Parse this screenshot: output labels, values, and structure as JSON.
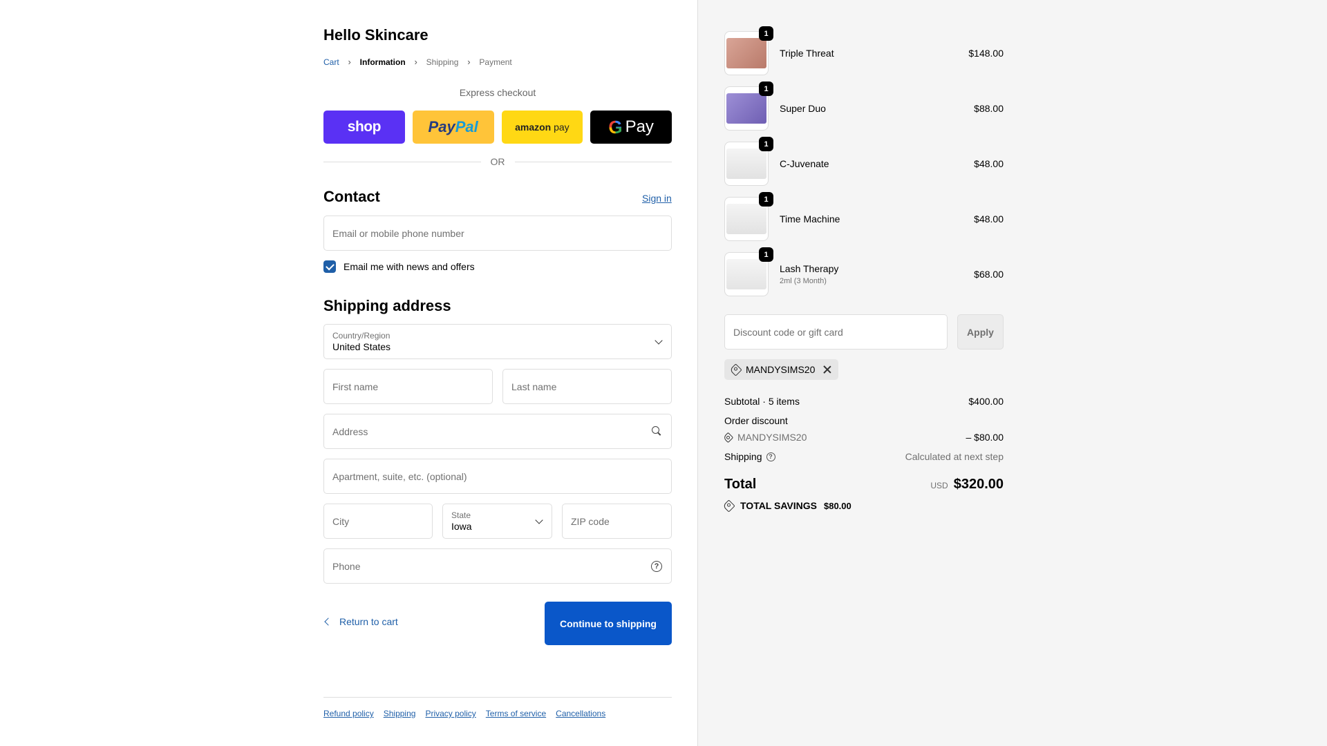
{
  "store": {
    "title": "Hello Skincare"
  },
  "breadcrumb": {
    "cart": "Cart",
    "information": "Information",
    "shipping": "Shipping",
    "payment": "Payment"
  },
  "express": {
    "label": "Express checkout",
    "shop": "shop",
    "paypal_a": "Pay",
    "paypal_b": "Pal",
    "amazon_a": "amazon",
    "amazon_b": " pay",
    "gpay_g": "G",
    "gpay": "Pay",
    "or": "OR"
  },
  "contact": {
    "title": "Contact",
    "sign_in": "Sign in",
    "email_placeholder": "Email or mobile phone number",
    "news_checkbox": "Email me with news and offers",
    "news_checked": true
  },
  "shipping_address": {
    "title": "Shipping address",
    "country_label": "Country/Region",
    "country_value": "United States",
    "first_name": "First name",
    "last_name": "Last name",
    "address": "Address",
    "apartment": "Apartment, suite, etc. (optional)",
    "city": "City",
    "state_label": "State",
    "state_value": "Iowa",
    "zip": "ZIP code",
    "phone": "Phone"
  },
  "actions": {
    "return": "Return to cart",
    "continue": "Continue to shipping"
  },
  "footer": {
    "links": [
      "Refund policy",
      "Shipping",
      "Privacy policy",
      "Terms of service",
      "Cancellations"
    ]
  },
  "order": {
    "items": [
      {
        "name": "Triple Threat",
        "variant": "",
        "price": "$148.00",
        "qty": "1",
        "thumb_color": "#c89484"
      },
      {
        "name": "Super Duo",
        "variant": "",
        "price": "$88.00",
        "qty": "1",
        "thumb_color": "#8b7bc7"
      },
      {
        "name": "C-Juvenate",
        "variant": "",
        "price": "$48.00",
        "qty": "1",
        "thumb_color": "#ececec"
      },
      {
        "name": "Time Machine",
        "variant": "",
        "price": "$48.00",
        "qty": "1",
        "thumb_color": "#ececec"
      },
      {
        "name": "Lash Therapy",
        "variant": "2ml (3 Month)",
        "price": "$68.00",
        "qty": "1",
        "thumb_color": "#ededed"
      }
    ],
    "discount_placeholder": "Discount code or gift card",
    "apply": "Apply",
    "applied_code": "MANDYSIMS20",
    "subtotal_label": "Subtotal · 5 items",
    "subtotal_value": "$400.00",
    "order_discount_label": "Order discount",
    "discount_code": "MANDYSIMS20",
    "discount_value": "– $80.00",
    "shipping_label": "Shipping",
    "shipping_value": "Calculated at next step",
    "total_label": "Total",
    "currency": "USD",
    "total_value": "$320.00",
    "savings_label": "TOTAL SAVINGS",
    "savings_value": "$80.00"
  },
  "colors": {
    "accent": "#0a57c9",
    "link": "#1f5fa8",
    "shop_pay": "#5a31f4",
    "paypal": "#ffc439",
    "amazon_pay": "#ffd814"
  }
}
